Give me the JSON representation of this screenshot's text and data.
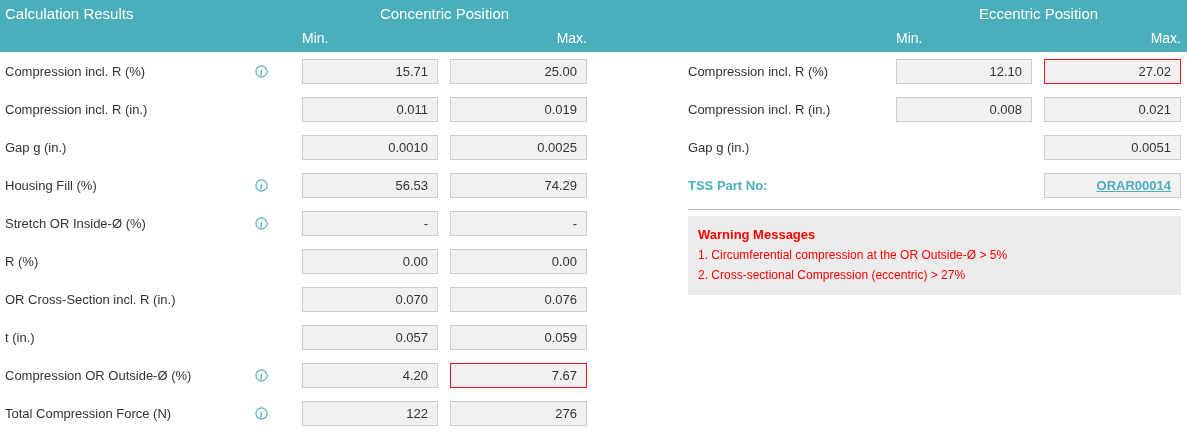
{
  "header": {
    "title": "Calculation Results",
    "concentric": {
      "title": "Concentric Position",
      "min": "Min.",
      "max": "Max."
    },
    "eccentric": {
      "title": "Eccentric Position",
      "min": "Min.",
      "max": "Max."
    }
  },
  "concentric_rows": [
    {
      "label": "Compression incl. R (%)",
      "info": true,
      "min": {
        "value": "15.71",
        "flagged": false
      },
      "max": {
        "value": "25.00",
        "flagged": false
      }
    },
    {
      "label": "Compression incl. R (in.)",
      "info": false,
      "min": {
        "value": "0.011",
        "flagged": false
      },
      "max": {
        "value": "0.019",
        "flagged": false
      }
    },
    {
      "label": "Gap g (in.)",
      "info": false,
      "min": {
        "value": "0.0010",
        "flagged": false
      },
      "max": {
        "value": "0.0025",
        "flagged": false
      }
    },
    {
      "label": "Housing Fill (%)",
      "info": true,
      "min": {
        "value": "56.53",
        "flagged": false
      },
      "max": {
        "value": "74.29",
        "flagged": false
      }
    },
    {
      "label": "Stretch OR Inside-Ø (%)",
      "info": true,
      "min": {
        "value": "-",
        "flagged": false
      },
      "max": {
        "value": "-",
        "flagged": false
      }
    },
    {
      "label": "R (%)",
      "info": false,
      "min": {
        "value": "0.00",
        "flagged": false
      },
      "max": {
        "value": "0.00",
        "flagged": false
      }
    },
    {
      "label": "OR Cross-Section incl. R (in.)",
      "info": false,
      "min": {
        "value": "0.070",
        "flagged": false
      },
      "max": {
        "value": "0.076",
        "flagged": false
      }
    },
    {
      "label": "t (in.)",
      "info": false,
      "min": {
        "value": "0.057",
        "flagged": false
      },
      "max": {
        "value": "0.059",
        "flagged": false
      }
    },
    {
      "label": "Compression OR Outside-Ø (%)",
      "info": true,
      "min": {
        "value": "4.20",
        "flagged": false
      },
      "max": {
        "value": "7.67",
        "flagged": true
      }
    },
    {
      "label": "Total Compression Force (N)",
      "info": true,
      "min": {
        "value": "122",
        "flagged": false
      },
      "max": {
        "value": "276",
        "flagged": false
      }
    }
  ],
  "eccentric_rows": [
    {
      "kind": "values",
      "label": "Compression incl. R (%)",
      "min": {
        "value": "12.10",
        "flagged": false
      },
      "max": {
        "value": "27.02",
        "flagged": true
      }
    },
    {
      "kind": "values",
      "label": "Compression incl. R (in.)",
      "min": {
        "value": "0.008",
        "flagged": false
      },
      "max": {
        "value": "0.021",
        "flagged": false
      }
    },
    {
      "kind": "values",
      "label": "Gap g (in.)",
      "max": {
        "value": "0.0051",
        "flagged": false
      }
    },
    {
      "kind": "part",
      "label": "TSS Part No:",
      "max": {
        "value": "ORAR00014",
        "flagged": false
      }
    }
  ],
  "warnings": {
    "title": "Warning Messages",
    "messages": [
      "1. Circumferential compression at the OR Outside-Ø > 5%",
      "2. Cross-sectional Compression (eccentric) > 27%"
    ]
  }
}
